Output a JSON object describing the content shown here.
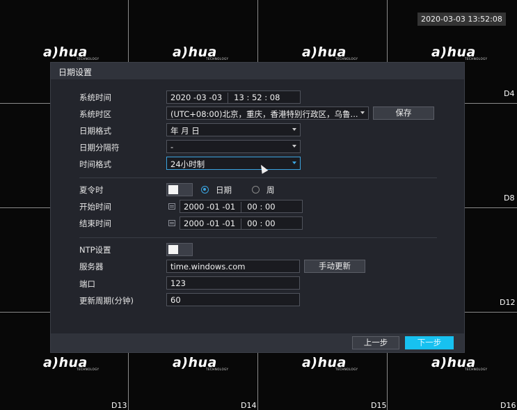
{
  "osd": {
    "clock": "2020-03-03 13:52:08"
  },
  "camera_grid": {
    "logo_text": "a)hua",
    "logo_sub": "TECHNOLOGY",
    "channels": [
      "D4",
      "D8",
      "D12",
      "D13",
      "D14",
      "D15",
      "D16"
    ]
  },
  "dialog": {
    "title": "日期设置",
    "system_time": {
      "label": "系统时间",
      "date": "2020 -03 -03",
      "time": "13 : 52 : 08"
    },
    "system_timezone": {
      "label": "系统时区",
      "value": "(UTC+08:00)北京，重庆，香港特别行政区，乌鲁...",
      "save_label": "保存"
    },
    "date_format": {
      "label": "日期格式",
      "value": "年 月 日"
    },
    "date_separator": {
      "label": "日期分隔符",
      "value": "-"
    },
    "time_format": {
      "label": "时间格式",
      "value": "24小时制"
    },
    "dst": {
      "label": "夏令时",
      "enabled": false,
      "mode_date": "日期",
      "mode_week": "周",
      "selected_mode": "日期",
      "start": {
        "label": "开始时间",
        "date": "2000 -01 -01",
        "time": "00 : 00"
      },
      "end": {
        "label": "结束时间",
        "date": "2000 -01 -01",
        "time": "00 : 00"
      }
    },
    "ntp": {
      "label": "NTP设置",
      "enabled": false,
      "server": {
        "label": "服务器",
        "value": "time.windows.com",
        "update_label": "手动更新"
      },
      "port": {
        "label": "端口",
        "value": "123"
      },
      "interval": {
        "label": "更新周期(分钟)",
        "value": "60"
      }
    },
    "footer": {
      "prev_label": "上一步",
      "next_label": "下一步"
    }
  },
  "colors": {
    "accent": "#17c1f0",
    "focus_border": "#3ba4e0",
    "panel": "#23252c"
  }
}
